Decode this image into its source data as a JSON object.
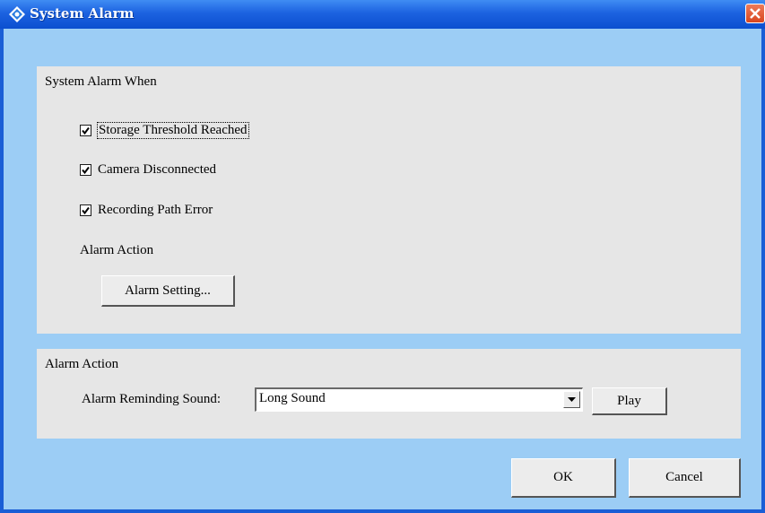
{
  "window": {
    "title": "System Alarm",
    "icon": "diamond-app-icon",
    "close_icon": "close-icon"
  },
  "alarm_when": {
    "title": "System Alarm When",
    "checkboxes": [
      {
        "label": "Storage Threshold Reached",
        "checked": true
      },
      {
        "label": "Camera Disconnected",
        "checked": true
      },
      {
        "label": "Recording Path Error",
        "checked": true
      }
    ],
    "alarm_action_label": "Alarm Action",
    "alarm_setting_button": "Alarm Setting..."
  },
  "alarm_action": {
    "title": "Alarm Action",
    "reminding_sound_label": "Alarm Reminding Sound:",
    "sound_selected": "Long Sound",
    "play_button": "Play"
  },
  "footer": {
    "ok_button": "OK",
    "cancel_button": "Cancel"
  },
  "colors": {
    "titlebar": "#1c62e0",
    "window_bg": "#9ccdf5",
    "panel_bg": "#e6e6e6",
    "close_button": "#d8461f"
  }
}
